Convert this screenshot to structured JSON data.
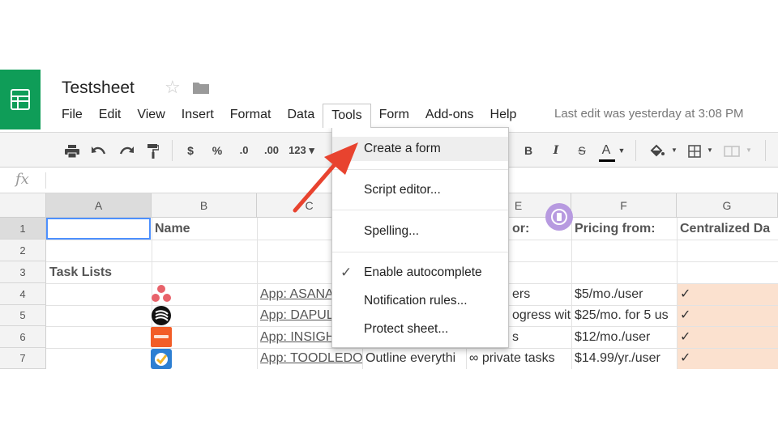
{
  "doc": {
    "title": "Testsheet",
    "last_edit": "Last edit was yesterday at 3:08 PM"
  },
  "menu": [
    "File",
    "Edit",
    "View",
    "Insert",
    "Format",
    "Data",
    "Tools",
    "Form",
    "Add-ons",
    "Help"
  ],
  "active_menu": "Tools",
  "toolbar": {
    "currency": "$",
    "percent": "%",
    "dec_decrease": ".0",
    "dec_increase": ".00",
    "more_formats": "123 ▾",
    "bold": "B",
    "italic": "I",
    "strike": "S",
    "text_color": "A"
  },
  "formula_bar": {
    "fx": "fx"
  },
  "columns": [
    "A",
    "B",
    "C",
    "D",
    "E",
    "F",
    "G"
  ],
  "rows": [
    "1",
    "2",
    "3",
    "4",
    "5",
    "6",
    "7"
  ],
  "cells": {
    "B1": "Name",
    "E1": "or:",
    "F1": "Pricing from:",
    "G1": "Centralized Da",
    "A3": "Task Lists",
    "C4": "App: ASANA",
    "C5": "App: DAPUL",
    "C6": "App: INSIGH",
    "C7": "App: TOODLEDO",
    "E4": "ers",
    "E5": "ogress wit",
    "E6": "s",
    "D7": "Outline everythi",
    "E7": "∞ private tasks",
    "F4": "$5/mo./user",
    "F5": "$25/mo. for 5 us",
    "F6": "$12/mo./user",
    "F7": "$14.99/yr./user",
    "G4": "✓",
    "G5": "✓",
    "G6": "✓",
    "G7": "✓"
  },
  "tools_menu": {
    "create_form": "Create a form",
    "script_editor": "Script editor...",
    "spelling": "Spelling...",
    "autocomplete": "Enable autocomplete",
    "notification_rules": "Notification rules...",
    "protect_sheet": "Protect sheet..."
  },
  "colors": {
    "brand_green": "#0f9d58",
    "highlight_peach": "#fbe1cf",
    "arrow_red": "#e8432f",
    "selection_blue": "#4d90fe"
  },
  "icons": {
    "sheets_logo": "sheets-logo-icon",
    "star": "star-icon",
    "folder": "folder-icon",
    "print": "print-icon",
    "undo": "undo-icon",
    "redo": "redo-icon",
    "paint_format": "paint-format-icon",
    "fill_color": "fill-color-icon",
    "borders": "borders-icon",
    "merge": "merge-cells-icon",
    "checkmark": "checkmark-icon",
    "annotation_arrow": "red-arrow-icon",
    "addon_badge": "addon-badge-icon"
  }
}
